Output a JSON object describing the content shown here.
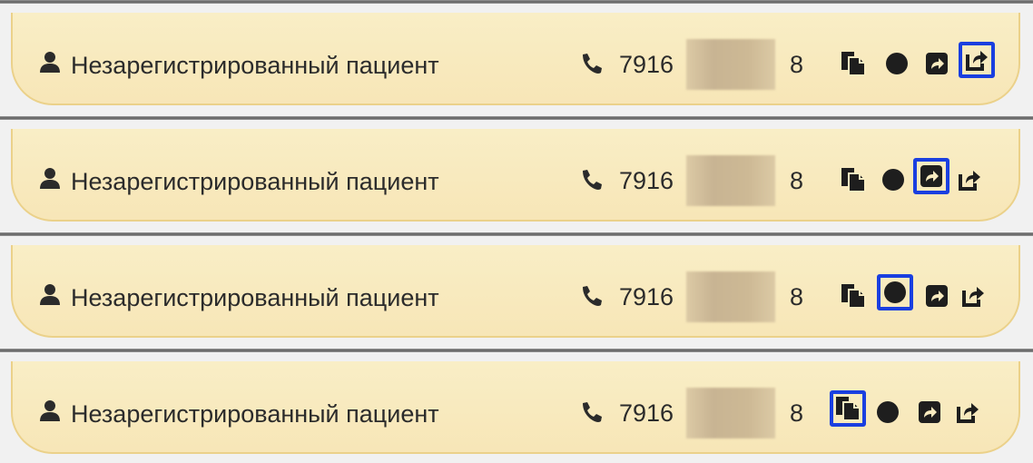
{
  "rows": [
    {
      "patient_label": "Незарегистрированный пациент",
      "phone_start": "7916",
      "phone_end": "8",
      "selected_tool": "share"
    },
    {
      "patient_label": "Незарегистрированный пациент",
      "phone_start": "7916",
      "phone_end": "8",
      "selected_tool": "forward"
    },
    {
      "patient_label": "Незарегистрированный пациент",
      "phone_start": "7916",
      "phone_end": "8",
      "selected_tool": "record"
    },
    {
      "patient_label": "Незарегистрированный пациент",
      "phone_start": "7916",
      "phone_end": "8",
      "selected_tool": "copy"
    }
  ],
  "icons": {
    "patient": "user-icon",
    "phone": "phone-icon",
    "tools": [
      "copy-icon",
      "record-dot-icon",
      "forward-square-icon",
      "share-icon"
    ]
  },
  "colors": {
    "card_bg": "#f8ebc0",
    "card_border": "#ebd18a",
    "text": "#2b2b2b",
    "selection": "#1a3fe0",
    "redaction": "#c8b493"
  }
}
